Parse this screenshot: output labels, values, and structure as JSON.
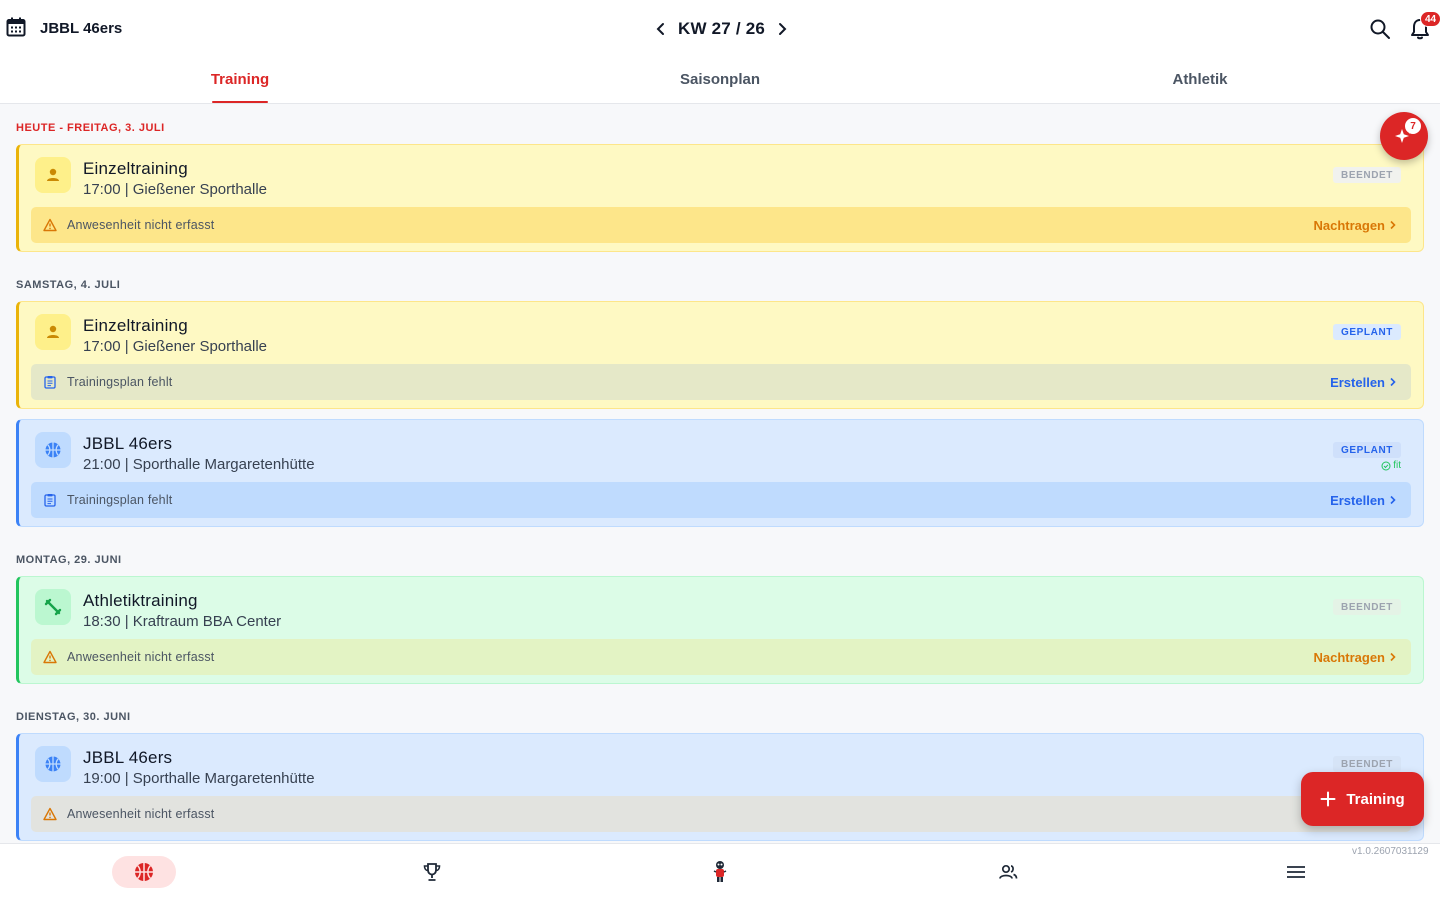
{
  "header": {
    "team_name": "JBBL 46ers",
    "week_label": "KW 27 / 26",
    "notification_count": "44"
  },
  "tabs": [
    {
      "label": "Training",
      "active": true
    },
    {
      "label": "Saisonplan",
      "active": false
    },
    {
      "label": "Athletik",
      "active": false
    }
  ],
  "ai_badge": "7",
  "days": [
    {
      "label": "HEUTE - FREITAG, 3. JULI",
      "events": [
        {
          "title": "Einzeltraining",
          "subtitle": "17:00 | Gießener Sporthalle",
          "status": "BEENDET",
          "type": "individual",
          "color": "yellow",
          "action": {
            "text": "Anwesenheit nicht erfasst",
            "link": "Nachtragen",
            "kind": "attendance"
          }
        }
      ]
    },
    {
      "label": "SAMSTAG, 4. JULI",
      "events": [
        {
          "title": "Einzeltraining",
          "subtitle": "17:00 | Gießener Sporthalle",
          "status": "GEPLANT",
          "type": "individual",
          "color": "yellow",
          "action": {
            "text": "Trainingsplan fehlt",
            "link": "Erstellen",
            "kind": "plan"
          }
        },
        {
          "title": "JBBL 46ers",
          "subtitle": "21:00 | Sporthalle Margaretenhütte",
          "status": "GEPLANT",
          "fit": "fit",
          "type": "team",
          "color": "blue",
          "action": {
            "text": "Trainingsplan fehlt",
            "link": "Erstellen",
            "kind": "plan"
          }
        }
      ]
    },
    {
      "label": "MONTAG, 29. JUNI",
      "events": [
        {
          "title": "Athletiktraining",
          "subtitle": "18:30 | Kraftraum BBA Center",
          "status": "BEENDET",
          "type": "athletic",
          "color": "green",
          "action": {
            "text": "Anwesenheit nicht erfasst",
            "link": "Nachtragen",
            "kind": "attendance"
          }
        }
      ]
    },
    {
      "label": "DIENSTAG, 30. JUNI",
      "events": [
        {
          "title": "JBBL 46ers",
          "subtitle": "19:00 | Sporthalle Margaretenhütte",
          "status": "BEENDET",
          "type": "team",
          "color": "blue",
          "action": {
            "text": "Anwesenheit nicht erfasst",
            "link": "",
            "kind": "attendance"
          }
        }
      ]
    }
  ],
  "add_button_label": "Training",
  "version": "v1.0.2607031129",
  "bottom_nav": [
    "basketball-icon",
    "trophy-icon",
    "mascot-icon",
    "users-icon",
    "menu-icon"
  ],
  "colors": {
    "accent": "#dc2626",
    "link_blue": "#2563eb",
    "link_orange": "#d97706"
  }
}
